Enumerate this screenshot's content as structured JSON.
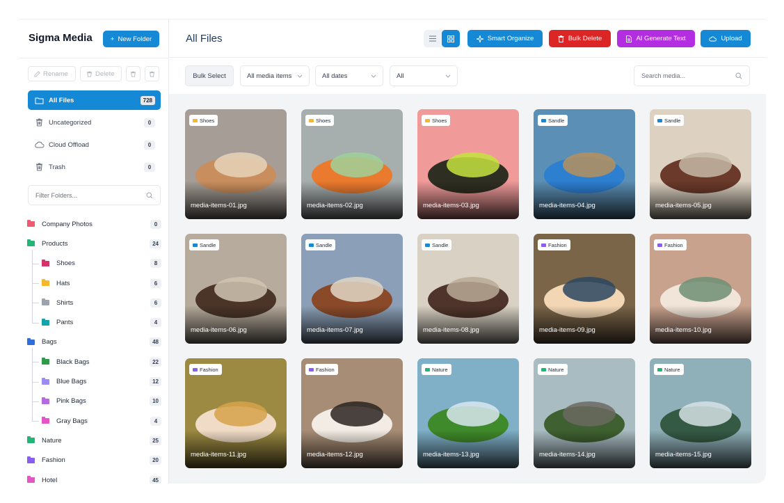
{
  "sidebar": {
    "brand": "Sigma Media",
    "new_folder": "New Folder",
    "actions": {
      "rename": "Rename",
      "delete": "Delete"
    },
    "nav": [
      {
        "label": "All Files",
        "count": "728",
        "icon": "folder-open-icon"
      },
      {
        "label": "Uncategorized",
        "count": "0",
        "icon": "trash-icon"
      },
      {
        "label": "Cloud Offload",
        "count": "0",
        "icon": "cloud-icon"
      },
      {
        "label": "Trash",
        "count": "0",
        "icon": "trash-icon"
      }
    ],
    "filter_placeholder": "Filter Folders...",
    "folders": [
      {
        "label": "Company Photos",
        "count": "0",
        "color": "#f05a6e",
        "child": false
      },
      {
        "label": "Products",
        "count": "24",
        "color": "#22b573",
        "child": false
      },
      {
        "label": "Shoes",
        "count": "8",
        "color": "#d6336c",
        "child": true
      },
      {
        "label": "Hats",
        "count": "6",
        "color": "#f5b82e",
        "child": true
      },
      {
        "label": "Shirts",
        "count": "6",
        "color": "#9ca3af",
        "child": true
      },
      {
        "label": "Pants",
        "count": "4",
        "color": "#14a3a8",
        "child": true
      },
      {
        "label": "Bags",
        "count": "48",
        "color": "#2f6fdb",
        "child": false
      },
      {
        "label": "Black Bags",
        "count": "22",
        "color": "#2e9a4a",
        "child": true
      },
      {
        "label": "Blue Bags",
        "count": "12",
        "color": "#9b8cf2",
        "child": true
      },
      {
        "label": "Pink Bags",
        "count": "10",
        "color": "#b36be0",
        "child": true
      },
      {
        "label": "Gray Bags",
        "count": "4",
        "color": "#e455c8",
        "child": true
      },
      {
        "label": "Nature",
        "count": "25",
        "color": "#22b573",
        "child": false
      },
      {
        "label": "Fashion",
        "count": "20",
        "color": "#8a5cf0",
        "child": false
      },
      {
        "label": "Hotel",
        "count": "45",
        "color": "#e455c8",
        "child": false
      }
    ]
  },
  "main": {
    "title": "All Files",
    "toolbar": {
      "smart_organize": "Smart Organize",
      "bulk_delete": "Bulk Delete",
      "ai_generate": "AI Generate Text",
      "upload": "Upload"
    },
    "filters": {
      "bulk_select": "Bulk Select",
      "media_type": "All media items",
      "dates": "All dates",
      "all": "All",
      "search_placeholder": "Search media..."
    },
    "colors": {
      "primary": "#1589d6",
      "danger": "#dc2626",
      "ai": "#b32ee0"
    },
    "media": [
      {
        "tag": "Shoes",
        "name": "media-items-01.jpg"
      },
      {
        "tag": "Shoes",
        "name": "media-items-02.jpg"
      },
      {
        "tag": "Shoes",
        "name": "media-items-03.jpg"
      },
      {
        "tag": "Sandle",
        "name": "media-items-04.jpg"
      },
      {
        "tag": "Sandle",
        "name": "media-items-05.jpg"
      },
      {
        "tag": "Sandle",
        "name": "media-items-06.jpg"
      },
      {
        "tag": "Sandle",
        "name": "media-items-07.jpg"
      },
      {
        "tag": "Sandle",
        "name": "media-items-08.jpg"
      },
      {
        "tag": "Fashion",
        "name": "media-items-09.jpg"
      },
      {
        "tag": "Fashion",
        "name": "media-items-10.jpg"
      },
      {
        "tag": "Fashion",
        "name": "media-items-11.jpg"
      },
      {
        "tag": "Fashion",
        "name": "media-items-12.jpg"
      },
      {
        "tag": "Nature",
        "name": "media-items-13.jpg"
      },
      {
        "tag": "Nature",
        "name": "media-items-14.jpg"
      },
      {
        "tag": "Nature",
        "name": "media-items-15.jpg"
      }
    ]
  }
}
